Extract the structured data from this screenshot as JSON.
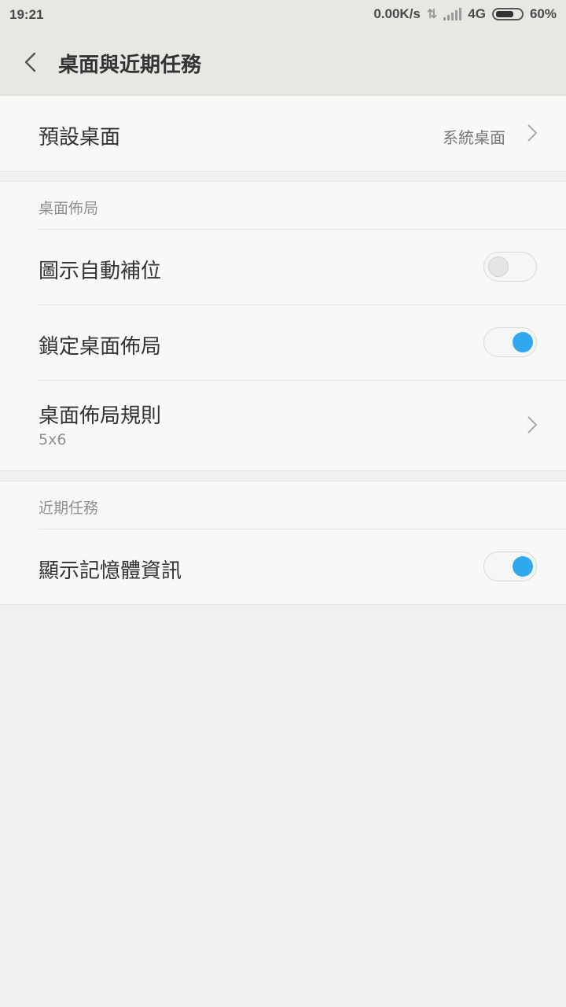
{
  "status_bar": {
    "time": "19:21",
    "network_speed": "0.00K/s",
    "network_type": "4G",
    "battery": "60%"
  },
  "header": {
    "title": "桌面與近期任務",
    "back_icon": "chevron-left-icon"
  },
  "default_launcher": {
    "label": "預設桌面",
    "value": "系統桌面"
  },
  "layout_section": {
    "header": "桌面佈局",
    "items": [
      {
        "label": "圖示自動補位",
        "type": "toggle",
        "checked": false
      },
      {
        "label": "鎖定桌面佈局",
        "type": "toggle",
        "checked": true
      },
      {
        "label": "桌面佈局規則",
        "sublabel": "5x6",
        "type": "link"
      }
    ]
  },
  "recents_section": {
    "header": "近期任務",
    "items": [
      {
        "label": "顯示記憶體資訊",
        "type": "toggle",
        "checked": true
      }
    ]
  },
  "colors": {
    "accent": "#2fa8ee",
    "background": "#eef1ed",
    "card": "#f7f9f6"
  }
}
